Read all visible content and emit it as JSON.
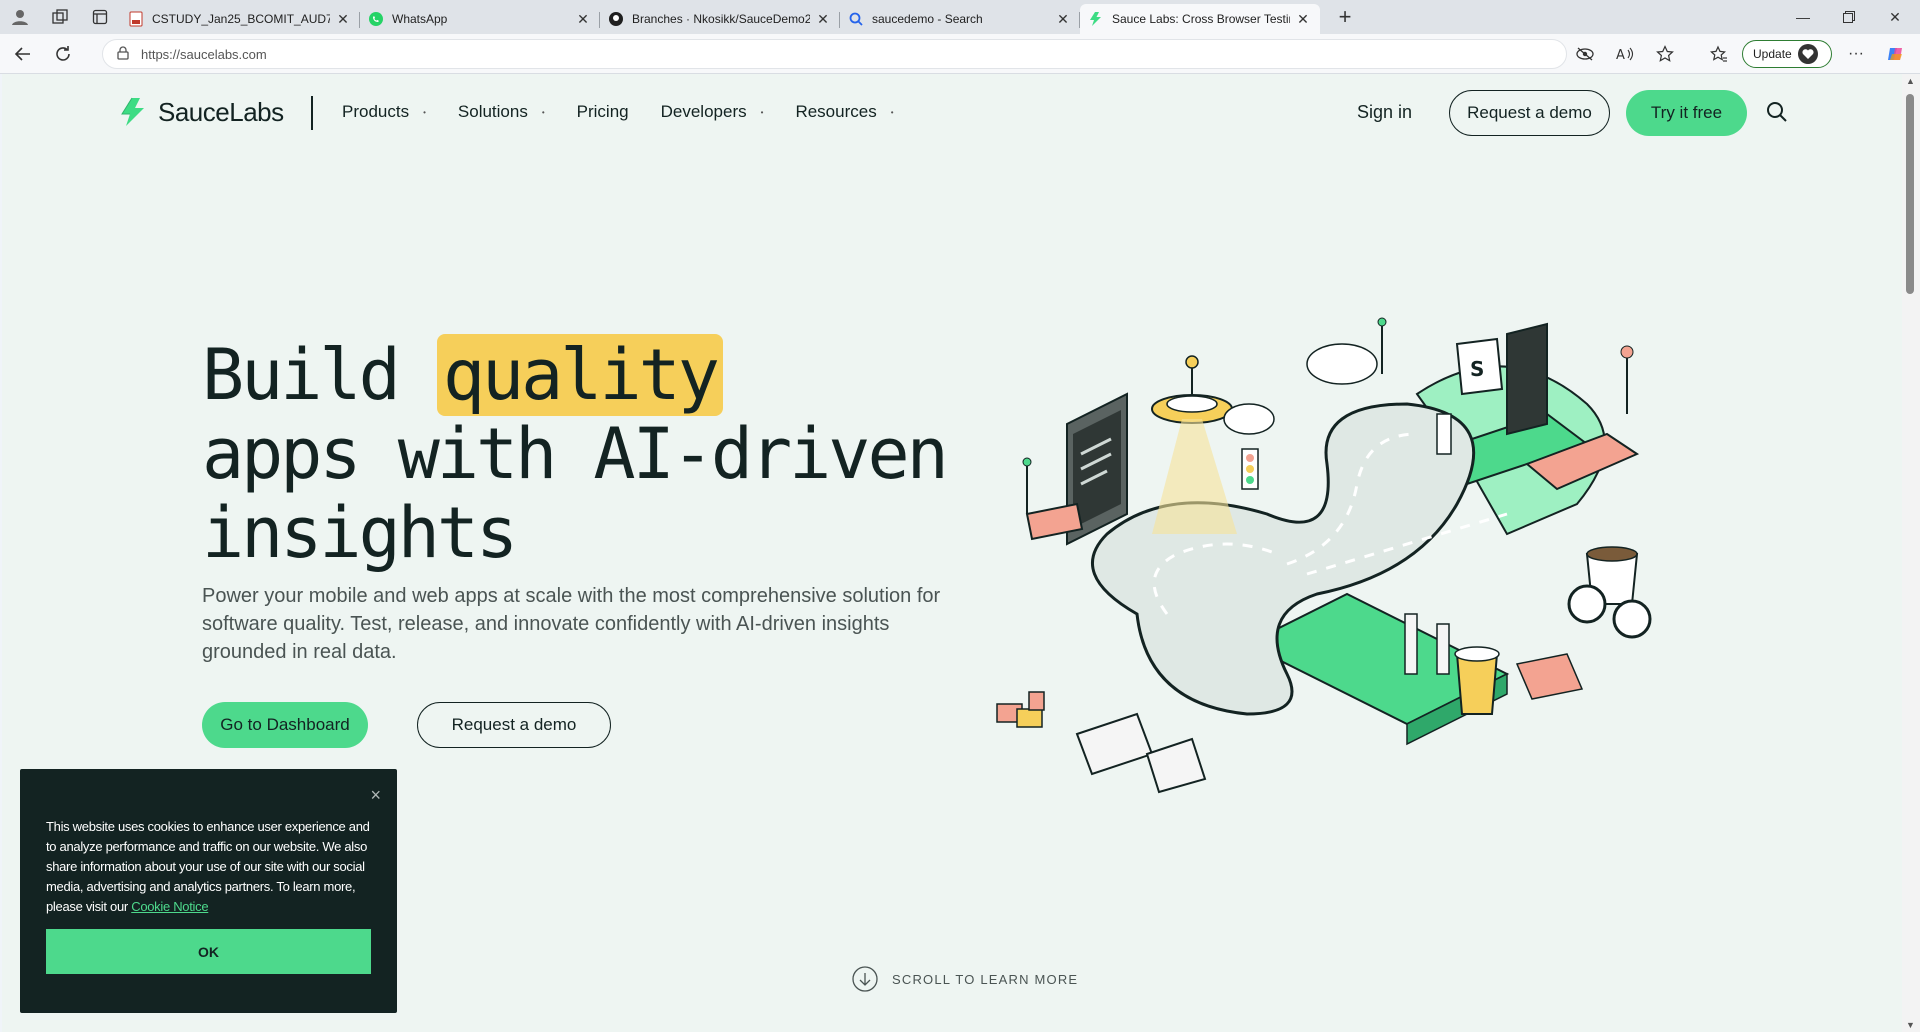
{
  "browser": {
    "tabs": [
      {
        "label": "CSTUDY_Jan25_BCOMIT_AUD7_Fi",
        "icon": "pdf-icon",
        "active": false
      },
      {
        "label": "WhatsApp",
        "icon": "whatsapp-icon",
        "active": false
      },
      {
        "label": "Branches · Nkosikk/SauceDemo2",
        "icon": "github-icon",
        "active": false
      },
      {
        "label": "saucedemo - Search",
        "icon": "search-icon",
        "active": false
      },
      {
        "label": "Sauce Labs: Cross Browser Testing",
        "icon": "saucelabs-icon",
        "active": true
      }
    ],
    "url": "https://saucelabs.com",
    "update_label": "Update"
  },
  "site": {
    "logo_text_regular": "Sauce",
    "logo_text_bold": "Labs",
    "nav": [
      {
        "label": "Products",
        "has_caret": true
      },
      {
        "label": "Solutions",
        "has_caret": true
      },
      {
        "label": "Pricing",
        "has_caret": false
      },
      {
        "label": "Developers",
        "has_caret": true
      },
      {
        "label": "Resources",
        "has_caret": true
      }
    ],
    "sign_in": "Sign in",
    "request_demo": "Request a demo",
    "try_free": "Try it free"
  },
  "hero": {
    "title_pre": "Build ",
    "title_highlight": "quality",
    "title_line2": "apps with AI-driven",
    "title_line3": "insights",
    "subtitle": "Power your mobile and web apps at scale with the most comprehensive solution for software quality. Test, release, and innovate confidently with AI-driven insights grounded in real data.",
    "primary_button": "Go to Dashboard",
    "secondary_button": "Request a demo",
    "scroll_hint": "SCROLL TO LEARN MORE"
  },
  "cookie": {
    "text": "This website uses cookies to enhance user experience and to analyze performance and traffic on our website. We also share information about your use of our site with our social media, advertising and analytics partners. To learn more, please visit our ",
    "link": "Cookie Notice",
    "ok": "OK",
    "close": "×"
  },
  "colors": {
    "brand_green": "#4dd98c",
    "highlight_yellow": "#f6cf5a",
    "dark": "#132322",
    "page_bg": "#eef5f2"
  }
}
